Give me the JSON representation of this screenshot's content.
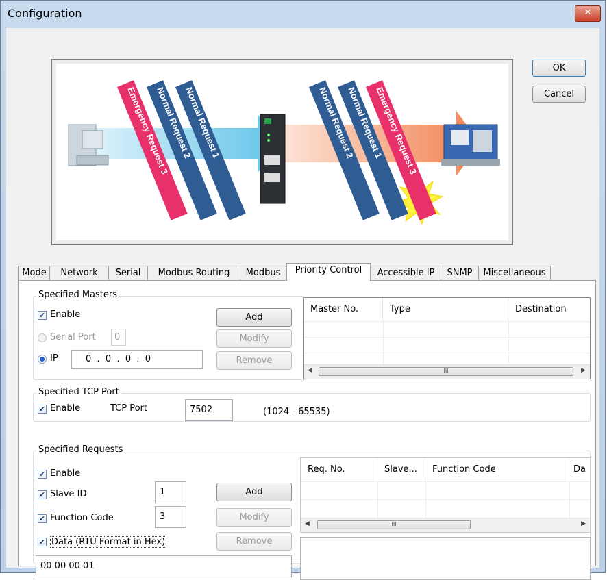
{
  "window": {
    "title": "Configuration",
    "close_label": "✕"
  },
  "dialog_buttons": {
    "ok": "OK",
    "cancel": "Cancel"
  },
  "illustration": {
    "left_bands": [
      "Emergency Request 3",
      "Normal Request 2",
      "Normal Request 1"
    ],
    "right_bands": [
      "Normal Request 2",
      "Normal Request 1",
      "Emergency Request 3"
    ]
  },
  "tabs": [
    "Mode",
    "Network",
    "Serial",
    "Modbus Routing",
    "Modbus",
    "Priority Control",
    "Accessible IP",
    "SNMP",
    "Miscellaneous"
  ],
  "active_tab": "Priority Control",
  "specified_masters": {
    "legend": "Specified Masters",
    "enable_label": "Enable",
    "enable_checked": true,
    "serial_port_label": "Serial Port",
    "serial_port_value": "0",
    "ip_label": "IP",
    "ip_value": "0  .  0  .  0  .  0",
    "add": "Add",
    "modify": "Modify",
    "remove": "Remove",
    "columns": [
      "Master No.",
      "Type",
      "Destination"
    ]
  },
  "specified_tcp_port": {
    "legend": "Specified TCP Port",
    "enable_label": "Enable",
    "enable_checked": true,
    "port_label": "TCP Port",
    "port_value": "7502",
    "range_hint": "(1024 - 65535)"
  },
  "specified_requests": {
    "legend": "Specified Requests",
    "enable_label": "Enable",
    "slave_id_label": "Slave ID",
    "slave_id_value": "1",
    "function_code_label": "Function Code",
    "function_code_value": "3",
    "data_label": "Data (RTU Format in Hex)",
    "data_value": "00 00 00 01",
    "add": "Add",
    "modify": "Modify",
    "remove": "Remove",
    "columns": [
      "Req. No.",
      "Slave...",
      "Function Code",
      "Da"
    ]
  },
  "scrollbar_grip": "III",
  "colors": {
    "emergency": "#e8306a",
    "normal": "#2f5d93",
    "arrow_blue": "#5ec3e8",
    "arrow_orange": "#f08a5a",
    "burst": "#fff23a"
  }
}
